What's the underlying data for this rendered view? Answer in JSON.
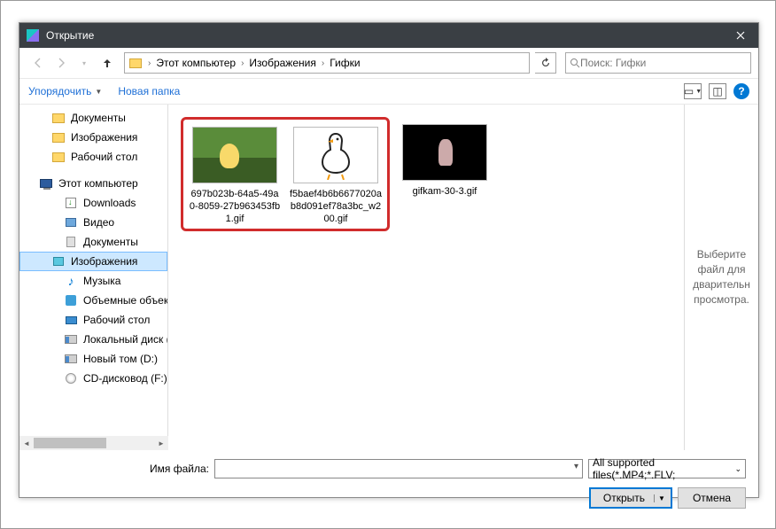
{
  "title": "Открытие",
  "breadcrumb": {
    "seg1": "Этот компьютер",
    "seg2": "Изображения",
    "seg3": "Гифки"
  },
  "search": {
    "placeholder": "Поиск: Гифки"
  },
  "toolbar": {
    "organize": "Упорядочить",
    "newfolder": "Новая папка"
  },
  "sidebar": {
    "docs": "Документы",
    "images": "Изображения",
    "desktop": "Рабочий стол",
    "pc": "Этот компьютер",
    "downloads": "Downloads",
    "video": "Видео",
    "docs2": "Документы",
    "images2": "Изображения",
    "music": "Музыка",
    "objects3d": "Объемные объекты",
    "desktop2": "Рабочий стол",
    "localdisk": "Локальный диск (C:)",
    "newvol": "Новый том (D:)",
    "cdrom": "CD-дисковод (F:)"
  },
  "files": {
    "f1": "697b023b-64a5-49a0-8059-27b963453fb1.gif",
    "f2": "f5baef4b6b667702\n0ab8d091ef78a3\nbc_w200.gif",
    "f2_plain": "f5baef4b6b6677020ab8d091ef78a3bc_w200.gif",
    "f3": "gifkam-30-3.gif"
  },
  "preview": "Выберите файл для дварительн просмотра.",
  "filename_label": "Имя файла:",
  "filter": "All supported files(*.MP4;*.FLV;",
  "open": "Открыть",
  "cancel": "Отмена"
}
